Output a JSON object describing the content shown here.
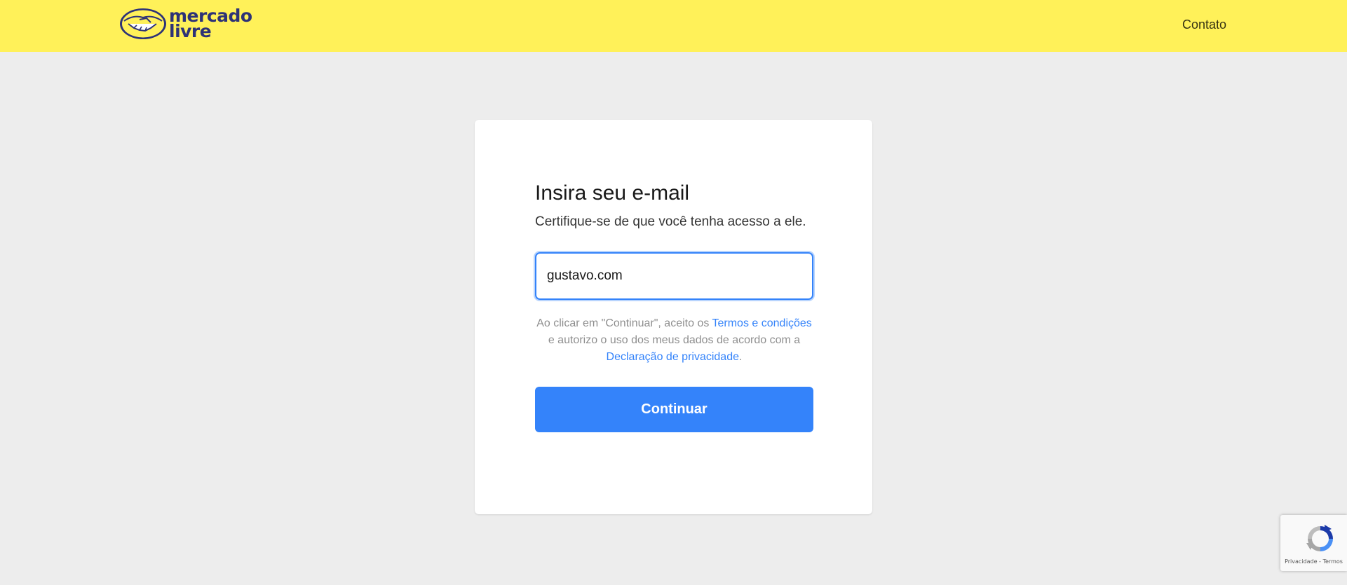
{
  "header": {
    "brand_line1": "mercado",
    "brand_line2": "livre",
    "contact_label": "Contato"
  },
  "login": {
    "title": "Insira seu e-mail",
    "subtitle": "Certifique-se de que você tenha acesso a ele.",
    "email_value": "gustavo.com",
    "terms_prefix": "Ao clicar em \"Continuar\", aceito os ",
    "terms_link": "Termos e condições",
    "terms_middle": " e autorizo o uso dos meus dados de acordo com a ",
    "privacy_link": "Declaração de privacidade",
    "terms_suffix": ".",
    "continue_label": "Continuar"
  },
  "recaptcha": {
    "privacy_label": "Privacidade",
    "separator": " - ",
    "terms_label": "Termos"
  },
  "colors": {
    "header_bg": "#fff159",
    "accent": "#3483fa",
    "brand_text": "#2d3277",
    "page_bg": "#ededed"
  }
}
